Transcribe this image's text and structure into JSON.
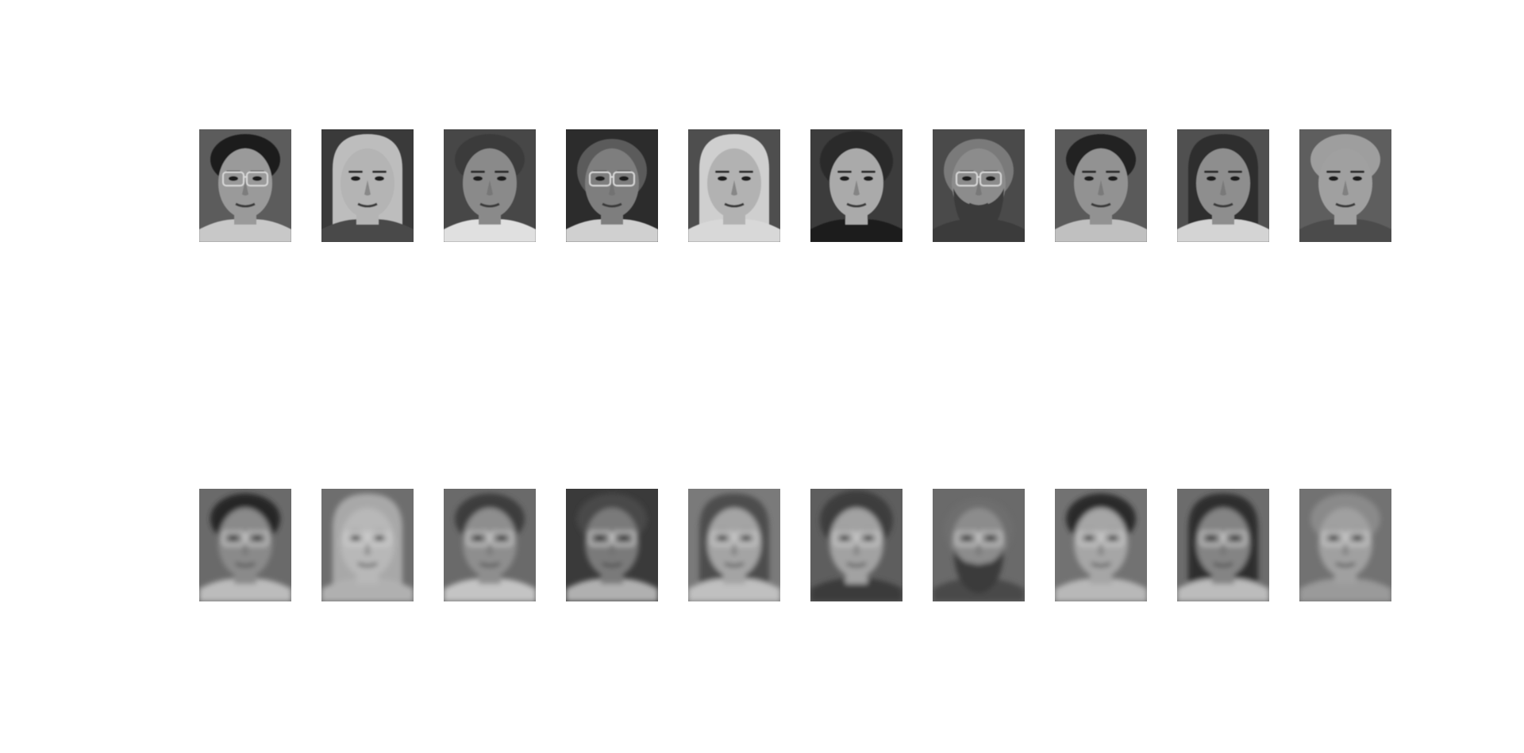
{
  "figure": {
    "rows": [
      {
        "kind": "original",
        "faces": [
          {
            "bg": "#5c5c5c",
            "hair": "#1e1e1e",
            "skin": "#9a9a9a",
            "shirt": "#c8c8c8",
            "glasses": true,
            "beard": false,
            "hairStyle": "short"
          },
          {
            "bg": "#3a3a3a",
            "hair": "#bdbdbd",
            "skin": "#b4b4b4",
            "shirt": "#4a4a4a",
            "glasses": false,
            "beard": false,
            "hairStyle": "long"
          },
          {
            "bg": "#474747",
            "hair": "#3a3a3a",
            "skin": "#8a8a8a",
            "shirt": "#e0e0e0",
            "glasses": false,
            "beard": false,
            "hairStyle": "short"
          },
          {
            "bg": "#2c2c2c",
            "hair": "#7a7a7a",
            "skin": "#7e7e7e",
            "shirt": "#d0d0d0",
            "glasses": true,
            "beard": false,
            "hairStyle": "bald"
          },
          {
            "bg": "#4e4e4e",
            "hair": "#cfcfcf",
            "skin": "#b2b2b2",
            "shirt": "#d8d8d8",
            "glasses": false,
            "beard": false,
            "hairStyle": "long"
          },
          {
            "bg": "#3c3c3c",
            "hair": "#2a2a2a",
            "skin": "#aaaaaa",
            "shirt": "#1e1e1e",
            "glasses": false,
            "beard": false,
            "hairStyle": "curly"
          },
          {
            "bg": "#4a4a4a",
            "hair": "#9a9a9a",
            "skin": "#8c8c8c",
            "shirt": "#3a3a3a",
            "glasses": true,
            "beard": true,
            "hairStyle": "bald"
          },
          {
            "bg": "#5a5a5a",
            "hair": "#222222",
            "skin": "#929292",
            "shirt": "#c0c0c0",
            "glasses": false,
            "beard": false,
            "hairStyle": "short"
          },
          {
            "bg": "#505050",
            "hair": "#2e2e2e",
            "skin": "#8e8e8e",
            "shirt": "#d4d4d4",
            "glasses": false,
            "beard": false,
            "hairStyle": "long"
          },
          {
            "bg": "#5e5e5e",
            "hair": "#9e9e9e",
            "skin": "#a0a0a0",
            "shirt": "#4c4c4c",
            "glasses": false,
            "beard": false,
            "hairStyle": "short"
          }
        ]
      },
      {
        "kind": "reconstructed",
        "faces": [
          {
            "bg": "#6a6a6a",
            "hair": "#252525",
            "skin": "#8a8a8a",
            "shirt": "#bcbcbc",
            "glasses": true,
            "beard": false,
            "hairStyle": "short"
          },
          {
            "bg": "#6e6e6e",
            "hair": "#a8a8a8",
            "skin": "#b8b8b8",
            "shirt": "#b0b0b0",
            "glasses": true,
            "beard": false,
            "hairStyle": "long"
          },
          {
            "bg": "#6a6a6a",
            "hair": "#3e3e3e",
            "skin": "#8e8e8e",
            "shirt": "#c4c4c4",
            "glasses": true,
            "beard": false,
            "hairStyle": "short"
          },
          {
            "bg": "#3a3a3a",
            "hair": "#4a4a4a",
            "skin": "#7a7a7a",
            "shirt": "#b0b0b0",
            "glasses": true,
            "beard": false,
            "hairStyle": "short"
          },
          {
            "bg": "#7a7a7a",
            "hair": "#4e4e4e",
            "skin": "#a4a4a4",
            "shirt": "#c0c0c0",
            "glasses": true,
            "beard": false,
            "hairStyle": "long"
          },
          {
            "bg": "#5e5e5e",
            "hair": "#3e3e3e",
            "skin": "#a2a2a2",
            "shirt": "#3a3a3a",
            "glasses": true,
            "beard": false,
            "hairStyle": "curly"
          },
          {
            "bg": "#6a6a6a",
            "hair": "#707070",
            "skin": "#8c8c8c",
            "shirt": "#4a4a4a",
            "glasses": true,
            "beard": true,
            "hairStyle": "bald"
          },
          {
            "bg": "#727272",
            "hair": "#2c2c2c",
            "skin": "#a6a6a6",
            "shirt": "#b8b8b8",
            "glasses": true,
            "beard": false,
            "hairStyle": "short"
          },
          {
            "bg": "#6c6c6c",
            "hair": "#2e2e2e",
            "skin": "#848484",
            "shirt": "#bcbcbc",
            "glasses": true,
            "beard": false,
            "hairStyle": "long"
          },
          {
            "bg": "#727272",
            "hair": "#8a8a8a",
            "skin": "#a0a0a0",
            "shirt": "#9a9a9a",
            "glasses": true,
            "beard": false,
            "hairStyle": "short"
          }
        ]
      }
    ]
  }
}
